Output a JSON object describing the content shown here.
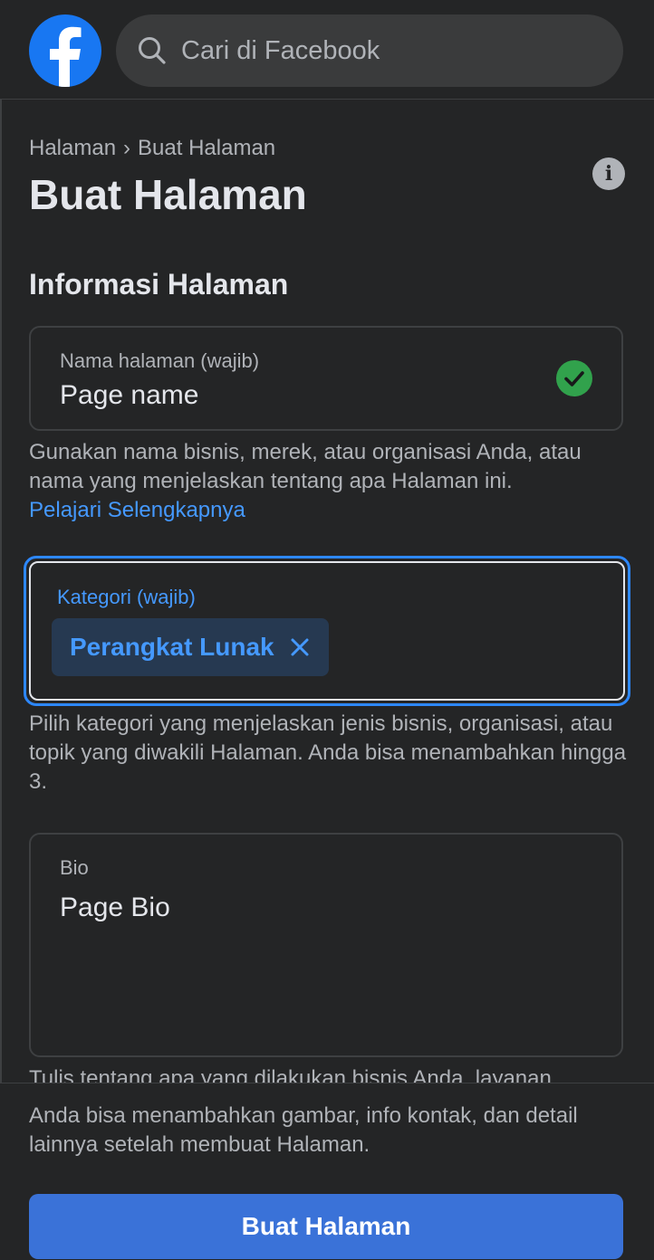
{
  "header": {
    "logo_icon": "facebook-logo-icon",
    "search": {
      "icon": "search-icon",
      "placeholder": "Cari di Facebook",
      "value": ""
    }
  },
  "breadcrumb": {
    "parent": "Halaman",
    "separator": "›",
    "current": "Buat Halaman"
  },
  "page": {
    "title": "Buat Halaman",
    "info_icon": "info-icon",
    "info_glyph": "i",
    "section_title": "Informasi Halaman"
  },
  "form": {
    "name_field": {
      "label": "Nama halaman (wajib)",
      "value": "Page name",
      "status_icon": "check-circle-icon",
      "help": "Gunakan nama bisnis, merek, atau organisasi Anda, atau nama yang menjelaskan tentang apa Halaman ini.",
      "learn_more": "Pelajari Selengkapnya"
    },
    "category_field": {
      "label": "Kategori (wajib)",
      "chips": [
        "Perangkat Lunak"
      ],
      "remove_icon": "close-icon",
      "help": "Pilih kategori yang menjelaskan jenis bisnis, organisasi, atau topik yang diwakili Halaman. Anda bisa menambahkan hingga 3."
    },
    "bio_field": {
      "label": "Bio",
      "value": "Page Bio",
      "help_partial": "Tulis tentang apa yang dilakukan bisnis Anda, layanan"
    }
  },
  "footer": {
    "note": "Anda bisa menambahkan gambar, info kontak, dan detail lainnya setelah membuat Halaman.",
    "submit_label": "Buat Halaman"
  },
  "colors": {
    "background": "#242526",
    "accent": "#2d88ff",
    "link": "#4599ff",
    "success": "#31a24c",
    "button": "#3a72d8"
  }
}
